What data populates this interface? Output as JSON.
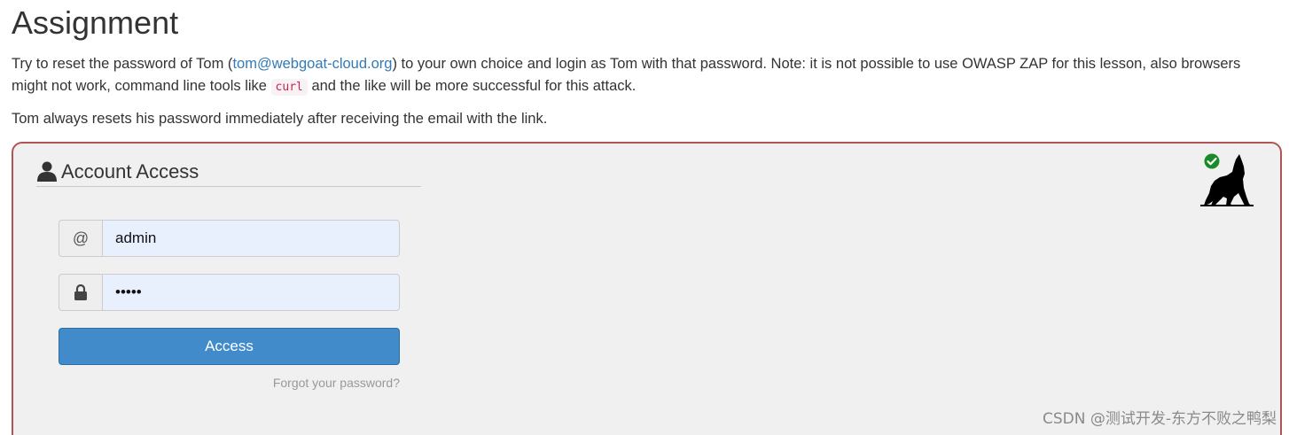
{
  "page": {
    "title": "Assignment",
    "intro_before_link": "Try to reset the password of Tom (",
    "intro_link": "tom@webgoat-cloud.org",
    "intro_after_link": ") to your own choice and login as Tom with that password. Note: it is not possible to use OWASP ZAP for this lesson, also browsers might not work, command line tools like ",
    "intro_code": "curl",
    "intro_end": " and the like will be more successful for this attack.",
    "note": "Tom always resets his password immediately after receiving the email with the link."
  },
  "login_panel": {
    "heading": "Account Access",
    "email_addon": "@",
    "email_value": "admin",
    "password_value": "•••••",
    "access_button": "Access",
    "forgot_link": "Forgot your password?",
    "status_icon": "check-circle-icon",
    "mascot_icon": "wolf-icon",
    "status_color": "#1a8a2a",
    "border_color": "#b05555",
    "button_color": "#428bca"
  },
  "watermark": {
    "text": "CSDN @测试开发-东方不败之鸭梨"
  }
}
